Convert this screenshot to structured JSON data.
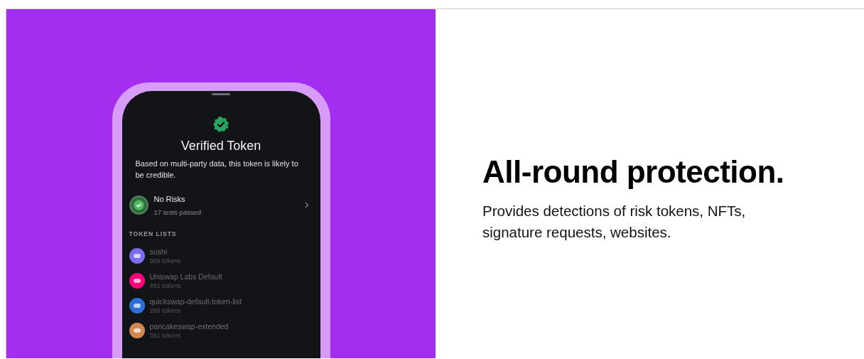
{
  "phone": {
    "title": "Verified Token",
    "description": "Based on multi-party data, this token is likely to be credible.",
    "risk": {
      "title": "No Risks",
      "subtitle": "17 tests passed"
    },
    "section_label": "TOKEN LISTS",
    "token_lists": [
      {
        "name": "sushi",
        "count": "989 tokens",
        "color": "#7b6cf0"
      },
      {
        "name": "Uniswap Labs Default",
        "count": "491 tokens",
        "color": "#ff007a"
      },
      {
        "name": "quickswap-default-token-list",
        "count": "280 tokens",
        "color": "#2c6fd6"
      },
      {
        "name": "pancakeswap-extended",
        "count": "351 tokens",
        "color": "#d1884f"
      }
    ]
  },
  "heading": "All-round protection.",
  "body": "Provides detections of risk tokens, NFTs, signature requests, websites."
}
